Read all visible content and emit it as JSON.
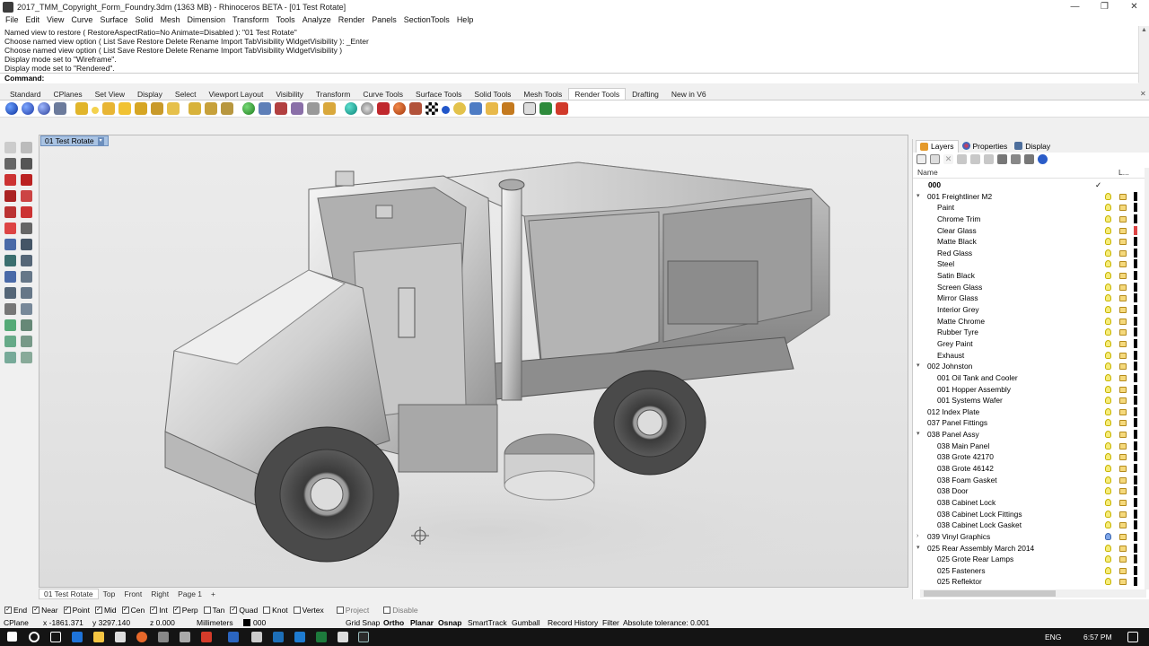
{
  "window": {
    "title": "2017_TMM_Copyright_Form_Foundry.3dm (1363 MB) - Rhinoceros BETA - [01 Test Rotate]",
    "minimize": "—",
    "maximize": "❐",
    "close": "✕"
  },
  "menu": [
    "File",
    "Edit",
    "View",
    "Curve",
    "Surface",
    "Solid",
    "Mesh",
    "Dimension",
    "Transform",
    "Tools",
    "Analyze",
    "Render",
    "Panels",
    "SectionTools",
    "Help"
  ],
  "command_history": [
    "Named view to restore ( RestoreAspectRatio=No  Animate=Disabled ): \"01 Test Rotate\"",
    "Choose named view option ( List  Save  Restore  Delete  Rename  Import  TabVisibility  WidgetVisibility ): _Enter",
    "Choose named view option ( List  Save  Restore  Delete  Rename  Import  TabVisibility  WidgetVisibility )",
    "Display mode set to \"Wireframe\".",
    "Display mode set to \"Rendered\"."
  ],
  "command_prompt": "Command:",
  "toolbar_tabs": [
    "Standard",
    "CPlanes",
    "Set View",
    "Display",
    "Select",
    "Viewport Layout",
    "Visibility",
    "Transform",
    "Curve Tools",
    "Surface Tools",
    "Solid Tools",
    "Mesh Tools",
    "Render Tools",
    "Drafting",
    "New in V6"
  ],
  "active_toolbar_tab": "Render Tools",
  "viewport": {
    "title": "01 Test Rotate",
    "dropdown": "▾"
  },
  "viewport_tabs": [
    "01 Test Rotate",
    "Top",
    "Front",
    "Right",
    "Page 1",
    "+"
  ],
  "panel_tabs": {
    "layers": "Layers",
    "properties": "Properties",
    "display": "Display"
  },
  "layer_columns": {
    "name": "Name",
    "more": "L..."
  },
  "layers": [
    {
      "name": "000",
      "indent": 0,
      "bold": true,
      "current": true
    },
    {
      "name": "001 Freightliner M2",
      "indent": 0,
      "expander": "▾"
    },
    {
      "name": "Paint",
      "indent": 2
    },
    {
      "name": "Chrome Trim",
      "indent": 2
    },
    {
      "name": "Clear Glass",
      "indent": 2
    },
    {
      "name": "Matte Black",
      "indent": 2
    },
    {
      "name": "Red Glass",
      "indent": 2
    },
    {
      "name": "Steel",
      "indent": 2
    },
    {
      "name": "Satin Black",
      "indent": 2
    },
    {
      "name": "Screen Glass",
      "indent": 2
    },
    {
      "name": "Mirror Glass",
      "indent": 2
    },
    {
      "name": "Interior Grey",
      "indent": 2
    },
    {
      "name": "Matte Chrome",
      "indent": 2
    },
    {
      "name": "Rubber Tyre",
      "indent": 2
    },
    {
      "name": "Grey Paint",
      "indent": 2
    },
    {
      "name": "Exhaust",
      "indent": 2
    },
    {
      "name": "002 Johnston",
      "indent": 0,
      "expander": "▾"
    },
    {
      "name": "001 Oil Tank and Cooler",
      "indent": 2
    },
    {
      "name": "001 Hopper Assembly",
      "indent": 2
    },
    {
      "name": "001 Systems Wafer",
      "indent": 2
    },
    {
      "name": "012 Index Plate",
      "indent": 1
    },
    {
      "name": "037 Panel Fittings",
      "indent": 1
    },
    {
      "name": "038 Panel Assy",
      "indent": 0,
      "expander": "▾"
    },
    {
      "name": "038 Main Panel",
      "indent": 2
    },
    {
      "name": "038 Grote 42170",
      "indent": 2
    },
    {
      "name": "038 Grote 46142",
      "indent": 2
    },
    {
      "name": "038 Foam Gasket",
      "indent": 2
    },
    {
      "name": "038 Door",
      "indent": 2
    },
    {
      "name": "038 Cabinet Lock",
      "indent": 2
    },
    {
      "name": "038 Cabinet Lock Fittings",
      "indent": 2
    },
    {
      "name": "038 Cabinet Lock Gasket",
      "indent": 2
    },
    {
      "name": "039 Vinyl Graphics",
      "indent": 0,
      "expander": "›"
    },
    {
      "name": "025 Rear Assembly March 2014",
      "indent": 0,
      "expander": "▾"
    },
    {
      "name": "025 Grote Rear Lamps",
      "indent": 2
    },
    {
      "name": "025 Fasteners",
      "indent": 2
    },
    {
      "name": "025 Reflektor",
      "indent": 2
    }
  ],
  "osnaps": [
    {
      "label": "End",
      "on": true
    },
    {
      "label": "Near",
      "on": true
    },
    {
      "label": "Point",
      "on": true
    },
    {
      "label": "Mid",
      "on": true
    },
    {
      "label": "Cen",
      "on": true
    },
    {
      "label": "Int",
      "on": true
    },
    {
      "label": "Perp",
      "on": true
    },
    {
      "label": "Tan",
      "on": false
    },
    {
      "label": "Quad",
      "on": true
    },
    {
      "label": "Knot",
      "on": false
    },
    {
      "label": "Vertex",
      "on": false
    },
    {
      "label": "Project",
      "on": false
    },
    {
      "label": "Disable",
      "on": false
    }
  ],
  "status": {
    "cplane": "CPlane",
    "x": "x -1861.371",
    "y": "y 3297.140",
    "z": "z 0.000",
    "units": "Millimeters",
    "layer": "000",
    "grid_snap": "Grid Snap",
    "ortho": "Ortho",
    "planar": "Planar",
    "osnap": "Osnap",
    "smarttrack": "SmartTrack",
    "gumball": "Gumball",
    "record_history": "Record History",
    "filter": "Filter",
    "tolerance": "Absolute tolerance: 0.001"
  },
  "taskbar": {
    "clock": "6:57 PM",
    "lang": "ENG"
  }
}
